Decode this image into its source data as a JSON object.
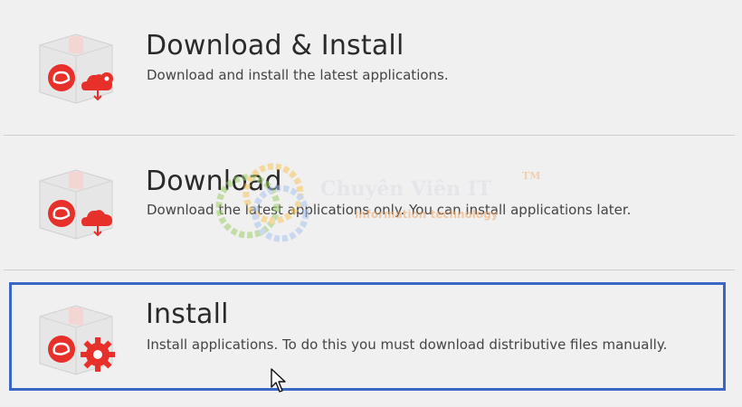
{
  "options": [
    {
      "title": "Download & Install",
      "description": "Download and install the latest applications.",
      "badge_icon": "cloud-gear-download-icon"
    },
    {
      "title": "Download",
      "description": "Download the latest applications only. You can install applications later.",
      "badge_icon": "cloud-download-icon"
    },
    {
      "title": "Install",
      "description": "Install applications. To do this you must download distributive files manually.",
      "badge_icon": "gear-icon"
    }
  ],
  "selected_option": "Install",
  "watermark": {
    "title": "Chuyên Viên IT",
    "tm": "TM",
    "subtitle": "information technology"
  },
  "colors": {
    "accent_red": "#e8302a",
    "selection_blue": "#3a66c4",
    "background": "#f1f0f0"
  }
}
